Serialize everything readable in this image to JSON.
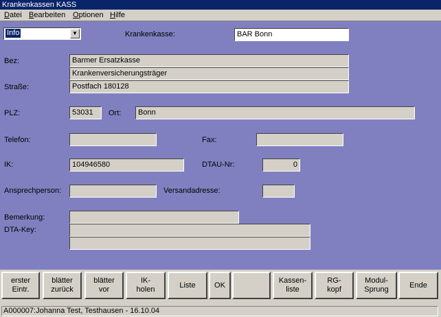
{
  "window": {
    "title": "Krankenkassen KASS"
  },
  "menu": {
    "items": [
      {
        "u": "D",
        "rest": "atei"
      },
      {
        "u": "B",
        "rest": "earbeiten"
      },
      {
        "u": "O",
        "rest": "ptionen"
      },
      {
        "u": "H",
        "rest": "ilfe"
      }
    ]
  },
  "form": {
    "view_select": {
      "value": "Info"
    },
    "krankenkasse": {
      "label": "Krankenkasse:",
      "value": "BAR Bonn"
    },
    "bez": {
      "label": "Bez:",
      "line1": "Barmer Ersatzkasse",
      "line2": "Krankenversicherungsträger"
    },
    "strasse": {
      "label": "Straße:",
      "value": "Postfach 180128"
    },
    "plz": {
      "label": "PLZ:",
      "value": "53031"
    },
    "ort": {
      "label": "Ort:",
      "value": "Bonn"
    },
    "telefon": {
      "label": "Telefon:",
      "value": ""
    },
    "fax": {
      "label": "Fax:",
      "value": ""
    },
    "ik": {
      "label": "IK:",
      "value": "104946580"
    },
    "dtau": {
      "label": "DTAU-Nr:",
      "value": "0"
    },
    "ansprechperson": {
      "label": "Ansprechperson:",
      "value": ""
    },
    "versandadresse": {
      "label": "Versandadresse:",
      "value": ""
    },
    "bemerkung": {
      "label": "Bemerkung:",
      "value": ""
    },
    "dtakey": {
      "label": "DTA-Key:",
      "line1": "",
      "line2": ""
    }
  },
  "buttons": {
    "erster": "erster\nEintr.",
    "zurueck": "blätter\nzurück",
    "vor": "blätter\nvor",
    "ik_holen": "IK-\nholen",
    "liste": "Liste",
    "ok": "OK",
    "blank": "",
    "kassenliste": "Kassen-\nliste",
    "rg_kopf": "RG-\nkopf",
    "modul_sprung": "Modul-\nSprung",
    "ende": "Ende"
  },
  "status": {
    "text": "A000007:Johanna Test, Testhausen - 16.10.04"
  }
}
